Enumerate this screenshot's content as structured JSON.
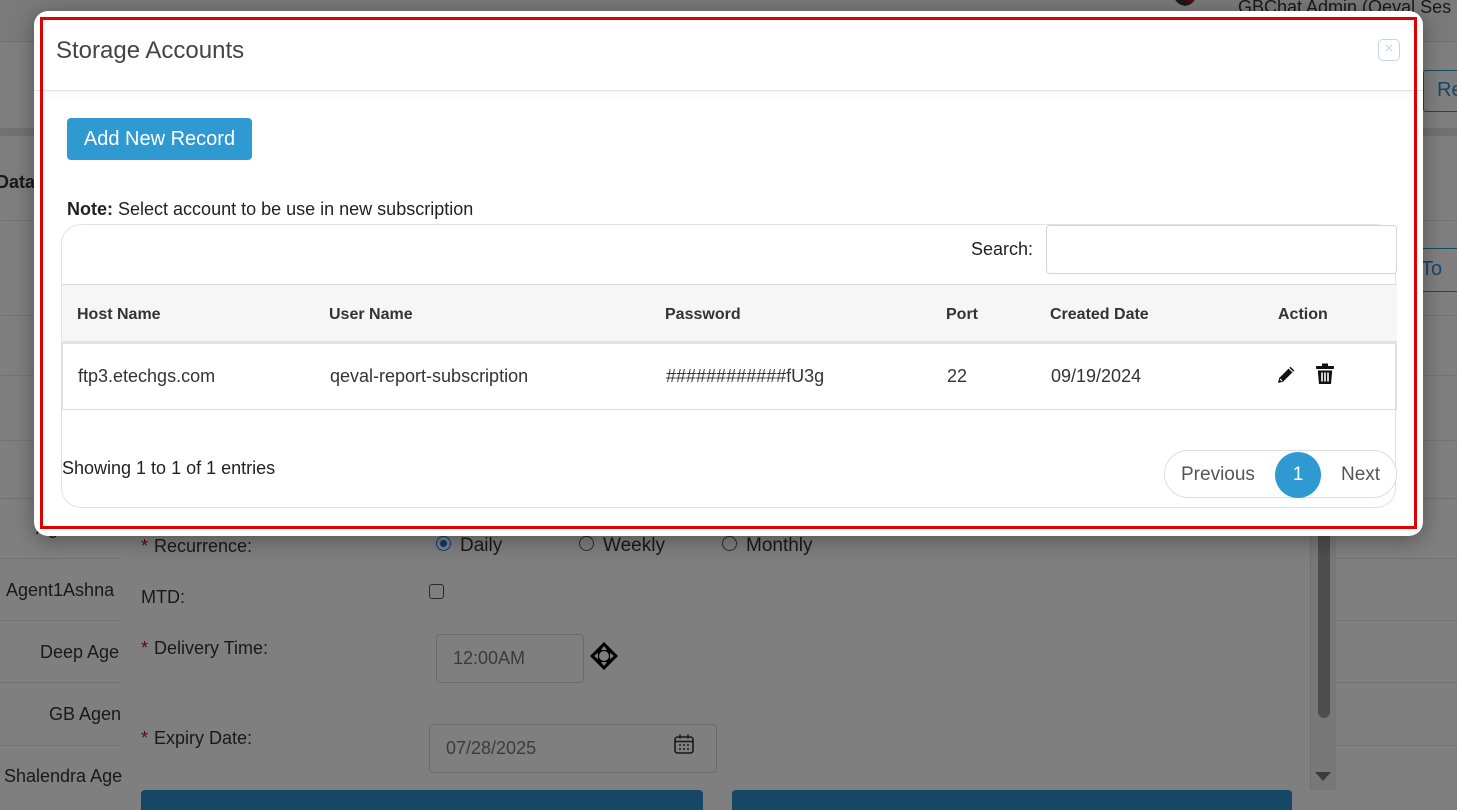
{
  "background": {
    "user_name": "GBChat Admin (Qeval Ses",
    "data_label": "Data",
    "re_button": "Re",
    "to_button": "To",
    "agents": [
      "Ag",
      "Agent1Ashna",
      "Deep Age",
      "GB Agen",
      "Shalendra Age"
    ]
  },
  "subscription_form": {
    "recurrence_label": "Recurrence:",
    "recurrence_options": [
      "Daily",
      "Weekly",
      "Monthly"
    ],
    "recurrence_selected": "Daily",
    "mtd_label": "MTD:",
    "mtd_checked": false,
    "delivery_time_label": "Delivery Time:",
    "delivery_time_value": "12:00AM",
    "expiry_date_label": "Expiry Date:",
    "expiry_date_value": "07/28/2025",
    "required_mark": "*"
  },
  "modal": {
    "title": "Storage Accounts",
    "close_symbol": "×",
    "add_button": "Add New Record",
    "note_label": "Note:",
    "note_text": "Select account to be use in new subscription",
    "search_label": "Search:",
    "search_value": "",
    "columns": [
      "Host Name",
      "User Name",
      "Password",
      "Port",
      "Created Date",
      "Action"
    ],
    "rows": [
      {
        "host": "ftp3.etechgs.com",
        "user": "qeval-report-subscription",
        "password": "############fU3g",
        "port": "22",
        "created": "09/19/2024"
      }
    ],
    "showing": "Showing 1 to 1 of 1 entries",
    "pagination": {
      "previous": "Previous",
      "current": "1",
      "next": "Next"
    }
  },
  "colors": {
    "accent": "#2f99d2",
    "highlight": "#e00000",
    "required": "#d9001b"
  }
}
